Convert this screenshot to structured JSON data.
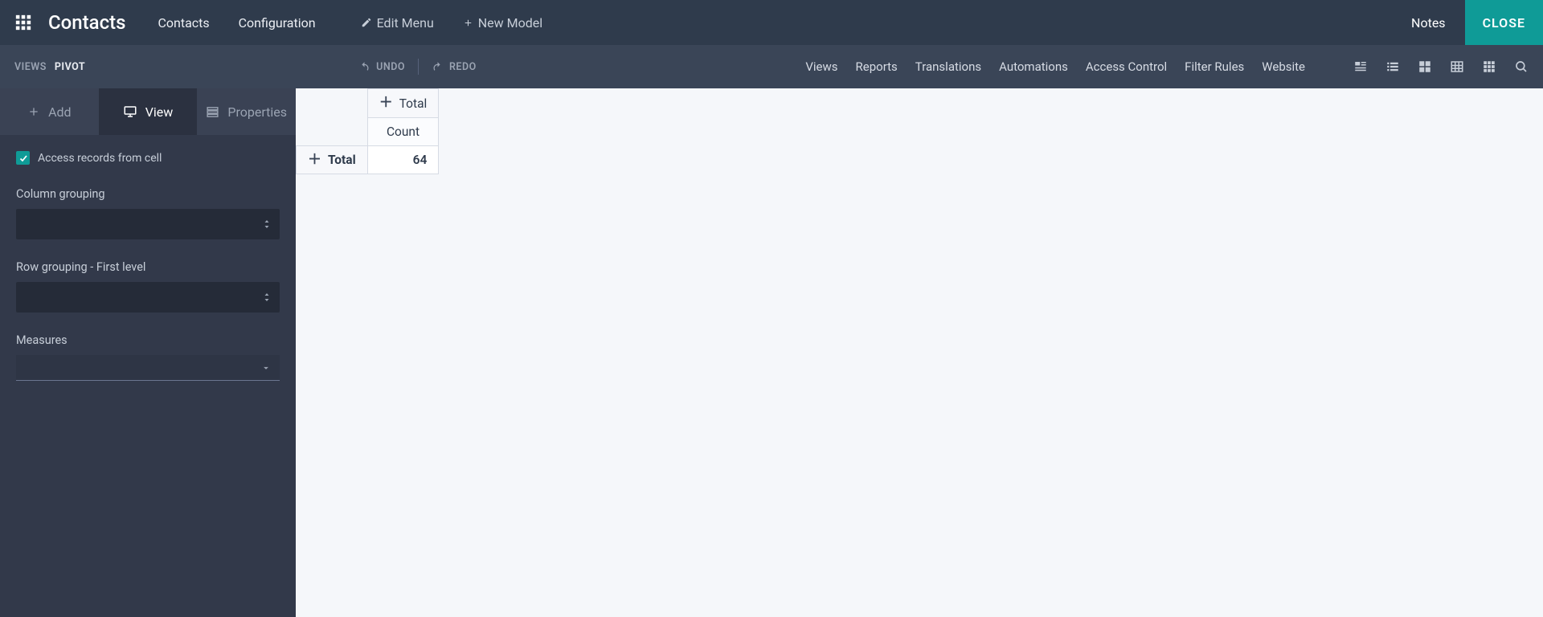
{
  "topbar": {
    "app_title": "Contacts",
    "menu": {
      "contacts": "Contacts",
      "configuration": "Configuration",
      "edit_menu": "Edit Menu",
      "new_model": "New Model"
    },
    "notes": "Notes",
    "close": "CLOSE"
  },
  "secondbar": {
    "breadcrumb_label": "VIEWS",
    "breadcrumb_current": "PIVOT",
    "undo": "UNDO",
    "redo": "REDO",
    "tabs": {
      "views": "Views",
      "reports": "Reports",
      "translations": "Translations",
      "automations": "Automations",
      "access_control": "Access Control",
      "filter_rules": "Filter Rules",
      "website": "Website"
    }
  },
  "sidebar": {
    "tabs": {
      "add": "Add",
      "view": "View",
      "properties": "Properties"
    },
    "access_checkbox": "Access records from cell",
    "column_grouping_label": "Column grouping",
    "row_grouping_label": "Row grouping - First level",
    "measures_label": "Measures"
  },
  "pivot": {
    "col_total": "Total",
    "count": "Count",
    "row_total": "Total",
    "value": "64"
  }
}
